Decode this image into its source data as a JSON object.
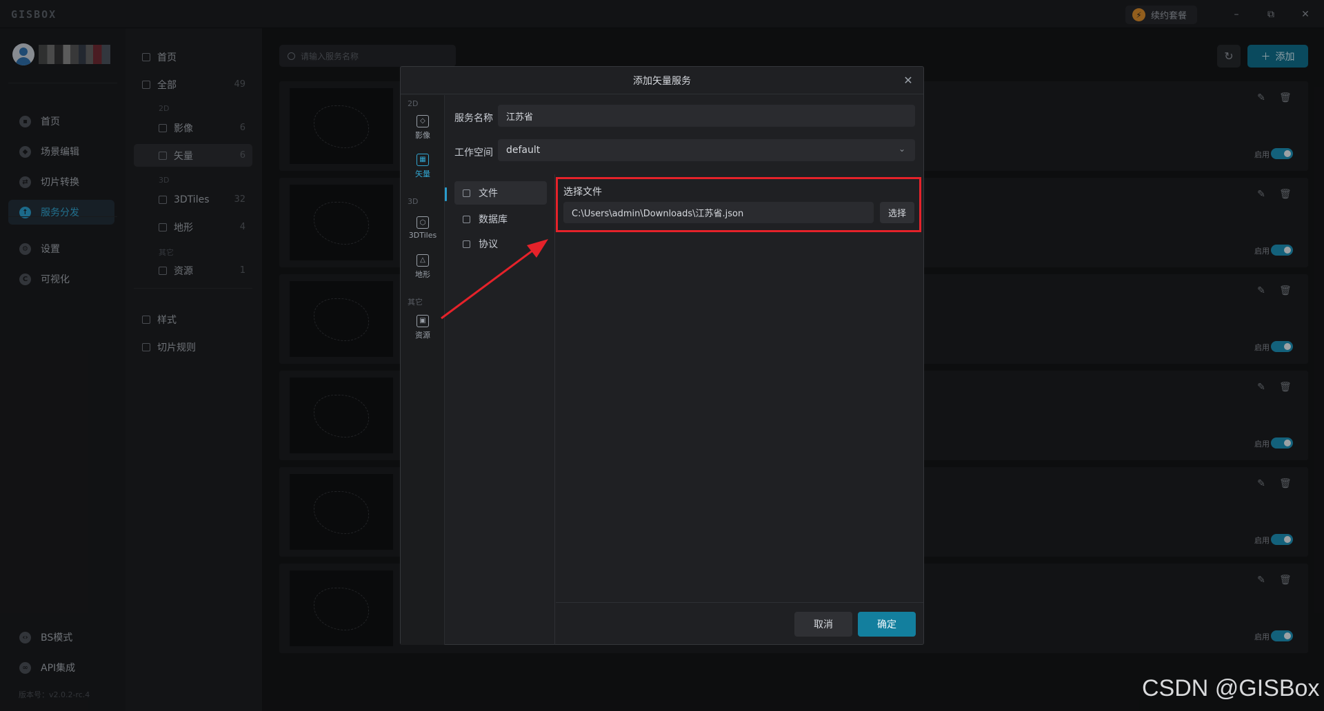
{
  "app": {
    "logo": "GISBOX",
    "renew_label": "续约套餐",
    "version": "版本号：v2.0.2-rc.4"
  },
  "window_controls": {
    "minimize": "–",
    "restore": "⧉",
    "close": "✕"
  },
  "left_nav": {
    "items": [
      {
        "label": "首页",
        "icon": "home-icon"
      },
      {
        "label": "场景编辑",
        "icon": "cube-icon"
      },
      {
        "label": "切片转换",
        "icon": "convert-icon"
      },
      {
        "label": "服务分发",
        "icon": "upload-icon",
        "active": true
      },
      {
        "label": "设置",
        "icon": "gear-icon"
      },
      {
        "label": "可视化",
        "icon": "chart-icon"
      }
    ],
    "bottom": [
      {
        "label": "BS模式",
        "icon": "code-icon"
      },
      {
        "label": "API集成",
        "icon": "link-icon"
      }
    ]
  },
  "category_nav": {
    "home": "首页",
    "all": {
      "label": "全部",
      "count": "49"
    },
    "groups": {
      "g2d": "2D",
      "g3d": "3D",
      "other": "其它"
    },
    "items": [
      {
        "label": "影像",
        "count": "6"
      },
      {
        "label": "矢量",
        "count": "6",
        "active": true
      },
      {
        "label": "3DTiles",
        "count": "32"
      },
      {
        "label": "地形",
        "count": "4"
      },
      {
        "label": "资源",
        "count": "1"
      }
    ],
    "style": "样式",
    "tile_rules": "切片规则"
  },
  "main": {
    "search_placeholder": "请输入服务名称",
    "refresh_icon": "refresh-icon",
    "add_label": "添加",
    "card_enable_label": "启用",
    "cards": [
      {
        "enabled": true
      },
      {
        "enabled": true
      },
      {
        "enabled": true
      },
      {
        "enabled": true
      },
      {
        "enabled": true
      },
      {
        "enabled": true
      }
    ]
  },
  "dialog": {
    "title": "添加矢量服务",
    "close_glyph": "✕",
    "rail": {
      "group_2d": "2D",
      "group_3d": "3D",
      "group_other": "其它",
      "items": [
        {
          "label": "影像",
          "icon": "imagery-icon"
        },
        {
          "label": "矢量",
          "icon": "vector-icon",
          "active": true
        },
        {
          "label": "3DTiles",
          "icon": "tiles-icon"
        },
        {
          "label": "地形",
          "icon": "terrain-icon"
        },
        {
          "label": "资源",
          "icon": "resource-icon"
        }
      ]
    },
    "service_name_label": "服务名称",
    "service_name_value": "江苏省",
    "workspace_label": "工作空间",
    "workspace_value": "default",
    "source_tabs": [
      {
        "label": "文件",
        "active": true
      },
      {
        "label": "数据库"
      },
      {
        "label": "协议"
      }
    ],
    "select_file_label": "选择文件",
    "file_path": "C:\\Users\\admin\\Downloads\\江苏省.json",
    "select_button": "选择",
    "cancel_button": "取消",
    "ok_button": "确定",
    "highlight_color": "#e5222a",
    "accent_color": "#137f9e"
  },
  "watermark": "CSDN @GISBox"
}
